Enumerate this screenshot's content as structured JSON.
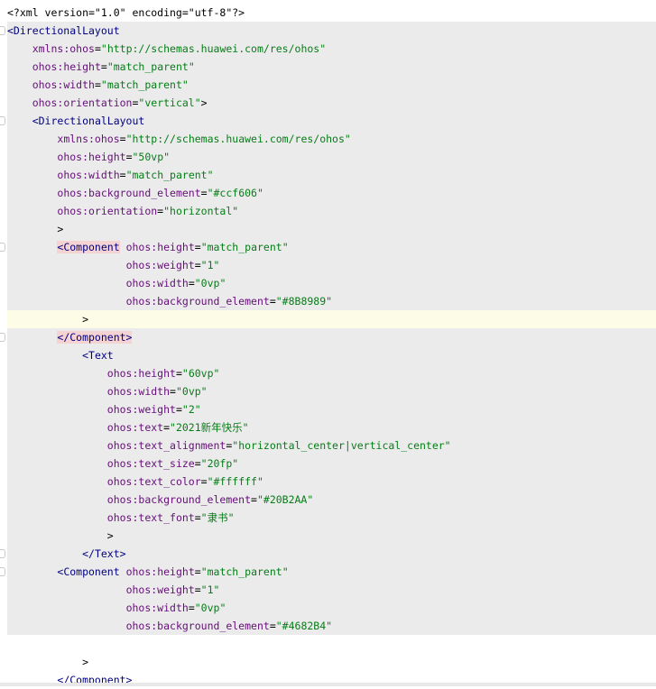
{
  "editor": {
    "lines": [
      [
        [
          "pi",
          "<?xml version=\"1.0\" encoding=\"utf-8\"?>"
        ]
      ],
      [
        [
          "tag",
          "<DirectionalLayout"
        ]
      ],
      [
        [
          "txt",
          "    "
        ],
        [
          "attr",
          "xmlns:ohos"
        ],
        [
          "pun",
          "="
        ],
        [
          "str",
          "\"http://schemas.huawei.com/res/ohos\""
        ]
      ],
      [
        [
          "txt",
          "    "
        ],
        [
          "attr",
          "ohos:height"
        ],
        [
          "pun",
          "="
        ],
        [
          "str",
          "\"match_parent\""
        ]
      ],
      [
        [
          "txt",
          "    "
        ],
        [
          "attr",
          "ohos:width"
        ],
        [
          "pun",
          "="
        ],
        [
          "str",
          "\"match_parent\""
        ]
      ],
      [
        [
          "txt",
          "    "
        ],
        [
          "attr",
          "ohos:orientation"
        ],
        [
          "pun",
          "="
        ],
        [
          "str",
          "\"vertical\""
        ],
        [
          "pun",
          ">"
        ]
      ],
      [
        [
          "txt",
          "    "
        ],
        [
          "tag",
          "<DirectionalLayout"
        ]
      ],
      [
        [
          "txt",
          "        "
        ],
        [
          "attr",
          "xmlns:ohos"
        ],
        [
          "pun",
          "="
        ],
        [
          "str",
          "\"http://schemas.huawei.com/res/ohos\""
        ]
      ],
      [
        [
          "txt",
          "        "
        ],
        [
          "attr",
          "ohos:height"
        ],
        [
          "pun",
          "="
        ],
        [
          "str",
          "\"50vp\""
        ]
      ],
      [
        [
          "txt",
          "        "
        ],
        [
          "attr",
          "ohos:width"
        ],
        [
          "pun",
          "="
        ],
        [
          "str",
          "\"match_parent\""
        ]
      ],
      [
        [
          "txt",
          "        "
        ],
        [
          "attr",
          "ohos:background_element"
        ],
        [
          "pun",
          "="
        ],
        [
          "str",
          "\"#ccf606\""
        ]
      ],
      [
        [
          "txt",
          "        "
        ],
        [
          "attr",
          "ohos:orientation"
        ],
        [
          "pun",
          "="
        ],
        [
          "str",
          "\"horizontal\""
        ]
      ],
      [
        [
          "txt",
          "        "
        ],
        [
          "pun",
          ">"
        ]
      ],
      [
        [
          "txt",
          "        "
        ],
        [
          "tagb",
          "<Component"
        ],
        [
          "txt",
          " "
        ],
        [
          "attr",
          "ohos:height"
        ],
        [
          "pun",
          "="
        ],
        [
          "str",
          "\"match_parent\""
        ]
      ],
      [
        [
          "txt",
          "                   "
        ],
        [
          "attr",
          "ohos:weight"
        ],
        [
          "pun",
          "="
        ],
        [
          "str",
          "\"1\""
        ]
      ],
      [
        [
          "txt",
          "                   "
        ],
        [
          "attr",
          "ohos:width"
        ],
        [
          "pun",
          "="
        ],
        [
          "str",
          "\"0vp\""
        ]
      ],
      [
        [
          "txt",
          "                   "
        ],
        [
          "attr",
          "ohos:background_element"
        ],
        [
          "pun",
          "="
        ],
        [
          "str",
          "\"#8B8989\""
        ]
      ],
      [
        [
          "txt",
          "            "
        ],
        [
          "pun",
          ">"
        ]
      ],
      [
        [
          "txt",
          "        "
        ],
        [
          "tagb",
          "</Component>"
        ]
      ],
      [
        [
          "txt",
          "            "
        ],
        [
          "tag",
          "<Text"
        ]
      ],
      [
        [
          "txt",
          "                "
        ],
        [
          "attr",
          "ohos:height"
        ],
        [
          "pun",
          "="
        ],
        [
          "str",
          "\"60vp\""
        ]
      ],
      [
        [
          "txt",
          "                "
        ],
        [
          "attr",
          "ohos:width"
        ],
        [
          "pun",
          "="
        ],
        [
          "str",
          "\"0vp\""
        ]
      ],
      [
        [
          "txt",
          "                "
        ],
        [
          "attr",
          "ohos:weight"
        ],
        [
          "pun",
          "="
        ],
        [
          "str",
          "\"2\""
        ]
      ],
      [
        [
          "txt",
          "                "
        ],
        [
          "attr",
          "ohos:text"
        ],
        [
          "pun",
          "="
        ],
        [
          "str",
          "\"2021新年快乐\""
        ]
      ],
      [
        [
          "txt",
          "                "
        ],
        [
          "attr",
          "ohos:text_alignment"
        ],
        [
          "pun",
          "="
        ],
        [
          "str",
          "\"horizontal_center|vertical_center\""
        ]
      ],
      [
        [
          "txt",
          "                "
        ],
        [
          "attr",
          "ohos:text_size"
        ],
        [
          "pun",
          "="
        ],
        [
          "str",
          "\"20fp\""
        ]
      ],
      [
        [
          "txt",
          "                "
        ],
        [
          "attr",
          "ohos:text_color"
        ],
        [
          "pun",
          "="
        ],
        [
          "str",
          "\"#ffffff\""
        ]
      ],
      [
        [
          "txt",
          "                "
        ],
        [
          "attr",
          "ohos:background_element"
        ],
        [
          "pun",
          "="
        ],
        [
          "str",
          "\"#20B2AA\""
        ]
      ],
      [
        [
          "txt",
          "                "
        ],
        [
          "attr",
          "ohos:text_font"
        ],
        [
          "pun",
          "="
        ],
        [
          "str",
          "\"隶书\""
        ]
      ],
      [
        [
          "txt",
          "                "
        ],
        [
          "pun",
          ">"
        ]
      ],
      [
        [
          "txt",
          "            "
        ],
        [
          "tag",
          "</Text>"
        ]
      ],
      [
        [
          "txt",
          "        "
        ],
        [
          "tag",
          "<Component"
        ],
        [
          "txt",
          " "
        ],
        [
          "attr",
          "ohos:height"
        ],
        [
          "pun",
          "="
        ],
        [
          "str",
          "\"match_parent\""
        ]
      ],
      [
        [
          "txt",
          "                   "
        ],
        [
          "attr",
          "ohos:weight"
        ],
        [
          "pun",
          "="
        ],
        [
          "str",
          "\"1\""
        ]
      ],
      [
        [
          "txt",
          "                   "
        ],
        [
          "attr",
          "ohos:width"
        ],
        [
          "pun",
          "="
        ],
        [
          "str",
          "\"0vp\""
        ]
      ],
      [
        [
          "txt",
          "                   "
        ],
        [
          "attr",
          "ohos:background_element"
        ],
        [
          "pun",
          "="
        ],
        [
          "str",
          "\"#4682B4\""
        ]
      ],
      [],
      [
        [
          "txt",
          "            "
        ],
        [
          "pun",
          ">"
        ]
      ],
      [
        [
          "txt",
          "        "
        ],
        [
          "tag",
          "</Component>"
        ]
      ]
    ],
    "highlighted_lines": [
      1,
      2,
      3,
      4,
      5,
      6,
      7,
      8,
      9,
      10,
      11,
      12,
      13,
      14,
      15,
      16,
      18,
      19,
      20,
      21,
      22,
      23,
      24,
      25,
      26,
      27,
      28,
      29,
      30,
      31,
      32,
      33,
      34
    ],
    "current_line": 17,
    "fold_markers": [
      1,
      6,
      13,
      18,
      30,
      31
    ]
  }
}
